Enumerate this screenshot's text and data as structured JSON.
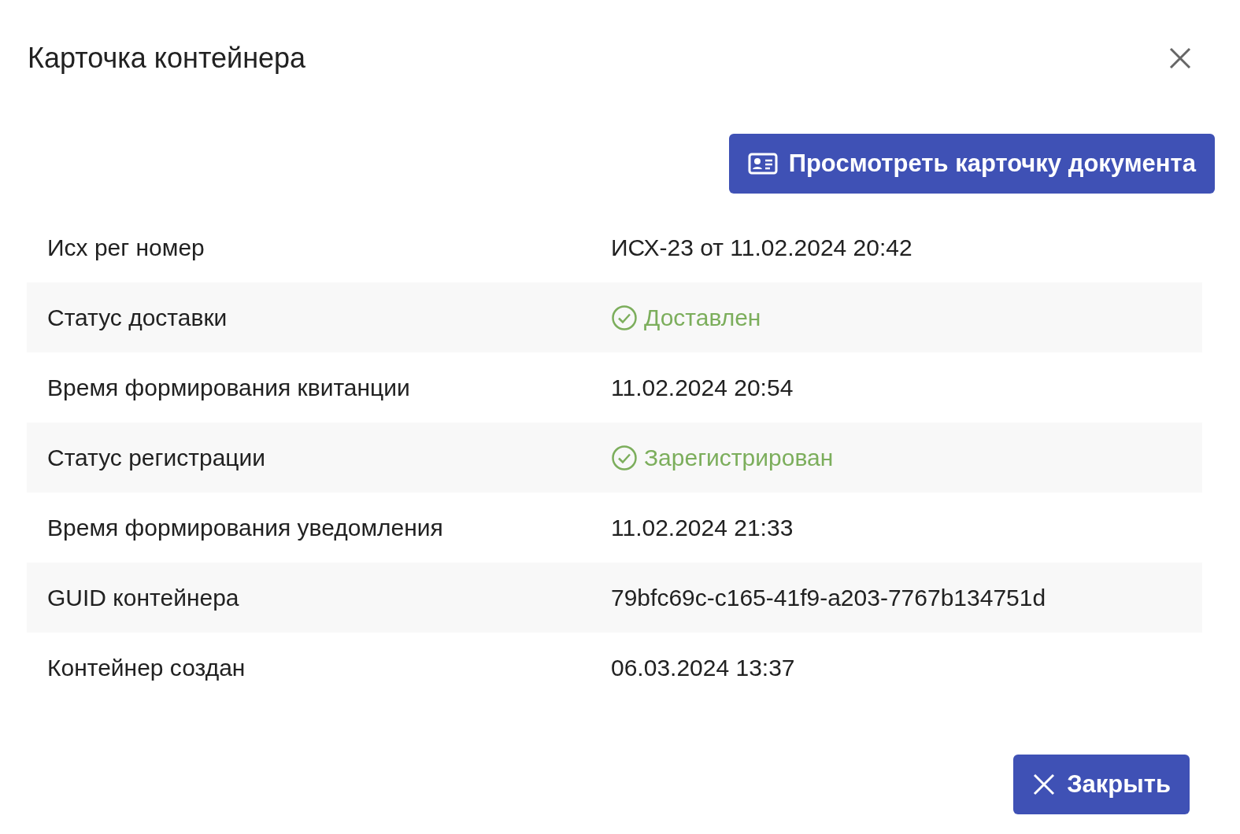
{
  "dialog": {
    "title": "Карточка контейнера"
  },
  "toolbar": {
    "button": "Просмотреть карточку документа"
  },
  "rows": [
    {
      "kind": "text",
      "label": "Исх рег номер",
      "value": "ИСХ-23 от 11.02.2024 20:42"
    },
    {
      "kind": "status",
      "label": "Статус доставки",
      "value": "Доставлен",
      "color": "#7cae5c"
    },
    {
      "kind": "text",
      "label": "Время формирования квитанции",
      "value": "11.02.2024 20:54"
    },
    {
      "kind": "status",
      "label": "Статус регистрации",
      "value": "Зарегистрирован",
      "color": "#7cae5c"
    },
    {
      "kind": "text",
      "label": "Время формирования уведомления",
      "value": "11.02.2024 21:33"
    },
    {
      "kind": "text",
      "label": "GUID контейнера",
      "value": "79bfc69c-c165-41f9-a203-7767b134751d"
    },
    {
      "kind": "text",
      "label": "Контейнер создан",
      "value": "06.03.2024 13:37"
    }
  ],
  "footer": {
    "button": "Закрыть"
  }
}
